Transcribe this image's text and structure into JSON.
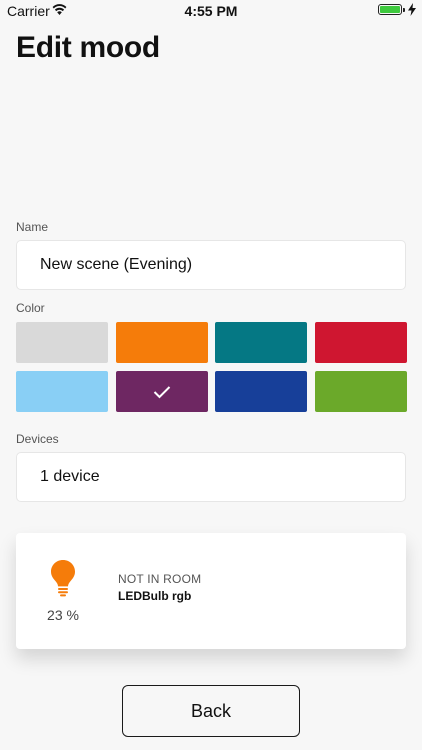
{
  "status_bar": {
    "carrier": "Carrier",
    "time": "4:55 PM",
    "battery_color": "#3ec93e"
  },
  "title": "Edit mood",
  "name_section": {
    "label": "Name",
    "value": "New scene (Evening)"
  },
  "color_section": {
    "label": "Color",
    "swatches": [
      {
        "color": "#d9d9d9",
        "selected": false
      },
      {
        "color": "#f57c0a",
        "selected": false
      },
      {
        "color": "#057884",
        "selected": false
      },
      {
        "color": "#cf1630",
        "selected": false
      },
      {
        "color": "#89cff5",
        "selected": false
      },
      {
        "color": "#6e2762",
        "selected": true
      },
      {
        "color": "#173f99",
        "selected": false
      },
      {
        "color": "#6ba92a",
        "selected": false
      }
    ]
  },
  "devices_section": {
    "label": "Devices",
    "value": "1 device"
  },
  "device_card": {
    "icon": "lightbulb-icon",
    "icon_color": "#f57c0a",
    "brightness": "23 %",
    "room": "NOT IN ROOM",
    "name": "LEDBulb rgb"
  },
  "back_button": {
    "label": "Back"
  }
}
